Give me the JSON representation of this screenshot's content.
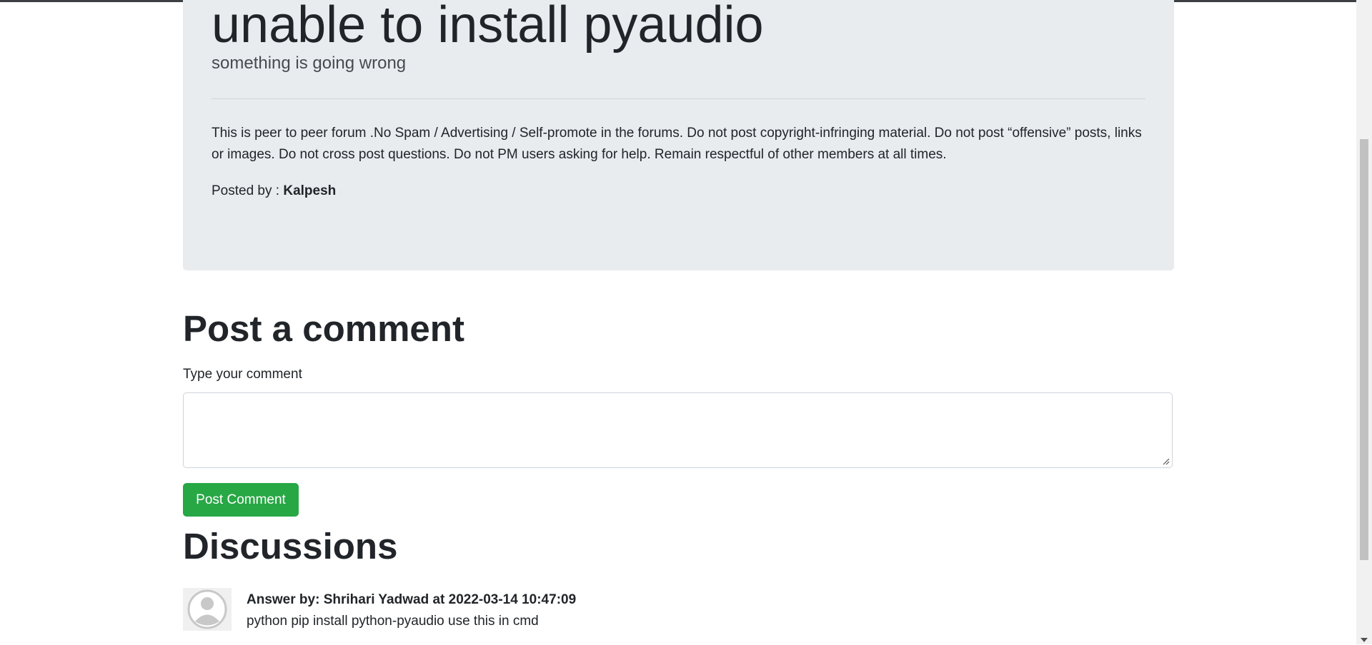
{
  "question": {
    "title": "unable to install pyaudio",
    "subtitle": "something is going wrong",
    "rules": "This is peer to peer forum .No Spam / Advertising / Self-promote in the forums. Do not post copyright-infringing material. Do not post “offensive” posts, links or images. Do not cross post questions. Do not PM users asking for help. Remain respectful of other members at all times.",
    "posted_by_label": "Posted by : ",
    "posted_by_name": "Kalpesh"
  },
  "comment_form": {
    "heading": "Post a comment",
    "label": "Type your comment",
    "value": "",
    "button_label": "Post Comment",
    "button_color": "#28a745"
  },
  "discussions": {
    "heading": "Discussions",
    "answers": [
      {
        "header": "Answer by: Shrihari Yadwad at 2022-03-14 10:47:09",
        "body": "python pip install python-pyaudio use this in cmd",
        "avatar_icon": "default-user-avatar-icon"
      }
    ]
  },
  "colors": {
    "jumbotron_bg": "#e9ecef",
    "text": "#212529"
  }
}
